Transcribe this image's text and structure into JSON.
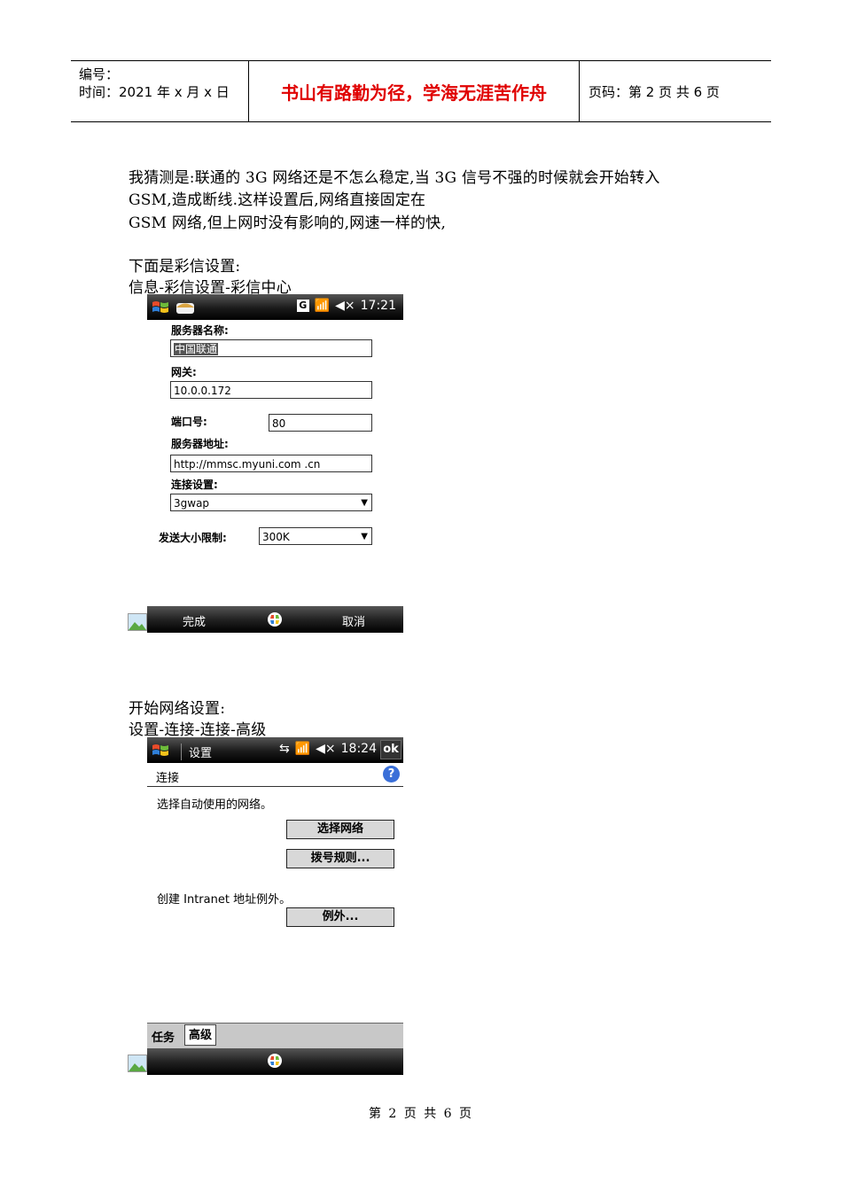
{
  "header": {
    "number_label": "编号：",
    "date_label": "时间：2021 年 x 月 x 日",
    "slogan": "书山有路勤为径，学海无涯苦作舟",
    "page_info": "页码：第 2 页  共 6 页"
  },
  "body": {
    "p1_line1": "我猜测是:联通的 3G 网络还是不怎么稳定,当 3G 信号不强的时候就会开始转入",
    "p1_line2": "GSM,造成断线.这样设置后,网络直接固定在",
    "p1_line3": "GSM 网络,但上网时没有影响的,网速一样的快,",
    "mms_heading": "下面是彩信设置:",
    "mms_path": "信息-彩信设置-彩信中心",
    "net_heading": "开始网络设置:",
    "net_path": "设置-连接-连接-高级"
  },
  "screen1": {
    "time": "17:21",
    "server_name_label": "服务器名称:",
    "server_name_value": "中国联通",
    "gateway_label": "网关:",
    "gateway_value": "10.0.0.172",
    "port_label": "端口号:",
    "port_value": "80",
    "server_addr_label": "服务器地址:",
    "server_addr_value": "http://mmsc.myuni.com .cn",
    "conn_label": "连接设置:",
    "conn_value": "3gwap",
    "size_label": "发送大小限制:",
    "size_value": "300K",
    "soft_left": "完成",
    "soft_right": "取消"
  },
  "screen2": {
    "title": "设置",
    "time": "18:24",
    "ok": "ok",
    "section": "连接",
    "auto_network_text": "选择自动使用的网络。",
    "select_network_button": "选择网络",
    "dial_rules_button": "拨号规则...",
    "intranet_text": "创建 Intranet 地址例外。",
    "exceptions_button": "例外...",
    "tab_tasks": "任务",
    "tab_advanced": "高级"
  },
  "footer": {
    "page_text": "第 2 页 共 6 页"
  },
  "colors": {
    "slogan": "#e00000",
    "bar": "#1a1a1a",
    "help": "#3a6fd8"
  }
}
